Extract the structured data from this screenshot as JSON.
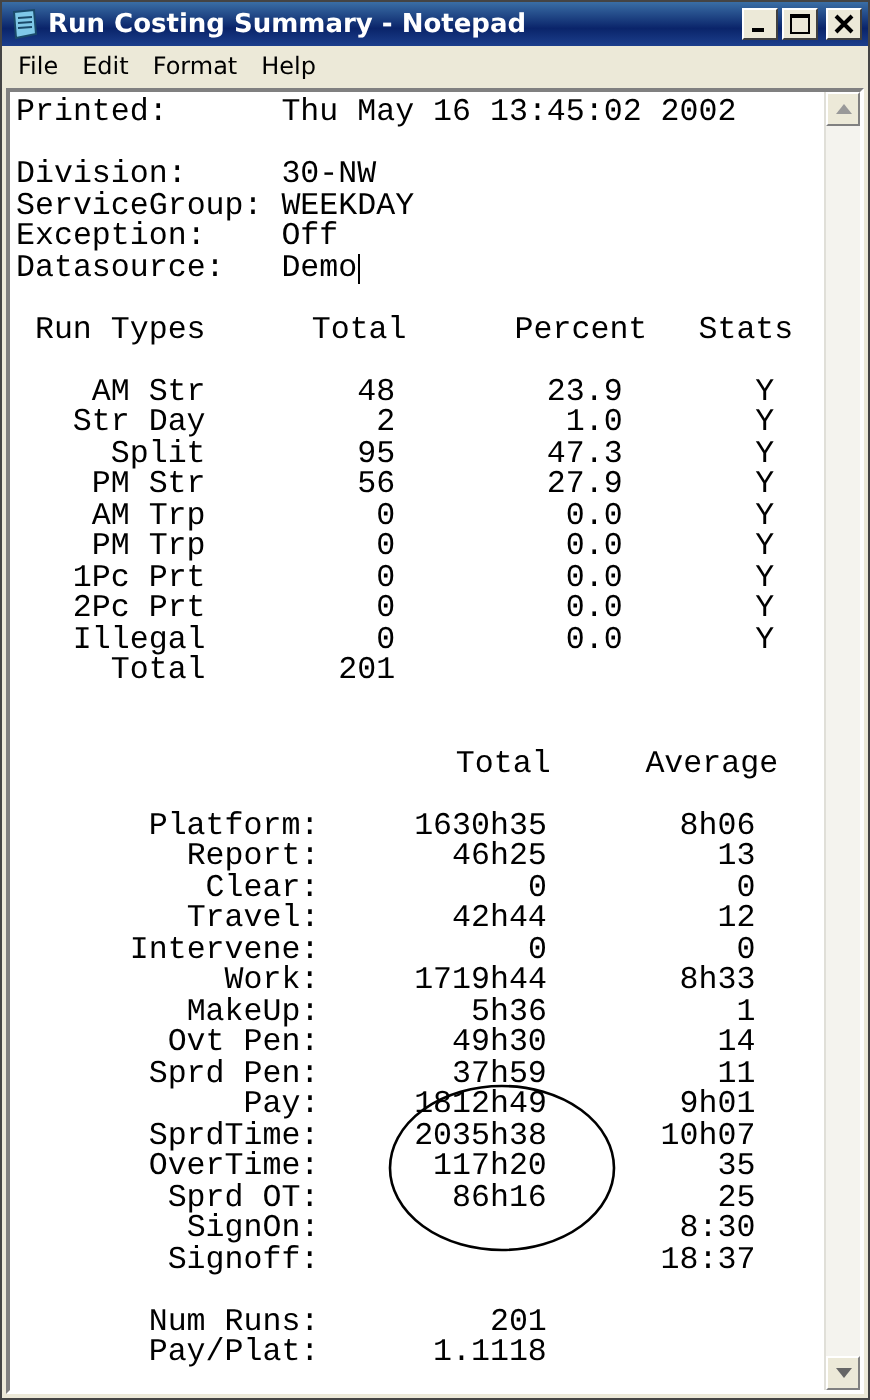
{
  "window": {
    "title": "Run Costing Summary - Notepad"
  },
  "menu": [
    "File",
    "Edit",
    "Format",
    "Help"
  ],
  "header_fields": [
    {
      "label": "Printed:",
      "value": "Thu May 16 13:45:02 2002",
      "caret": false
    },
    {
      "label": "Division:",
      "value": "30-NW",
      "caret": false
    },
    {
      "label": "ServiceGroup:",
      "value": "WEEKDAY",
      "caret": false
    },
    {
      "label": "Exception:",
      "value": "Off",
      "caret": false
    },
    {
      "label": "Datasource:",
      "value": "Demo",
      "caret": true
    }
  ],
  "run_types": {
    "columns": [
      "Run Types",
      "Total",
      "Percent",
      "Stats"
    ],
    "rows": [
      {
        "type": "AM Str",
        "total": "48",
        "percent": "23.9",
        "stats": "Y"
      },
      {
        "type": "Str Day",
        "total": "2",
        "percent": "1.0",
        "stats": "Y"
      },
      {
        "type": "Split",
        "total": "95",
        "percent": "47.3",
        "stats": "Y"
      },
      {
        "type": "PM Str",
        "total": "56",
        "percent": "27.9",
        "stats": "Y"
      },
      {
        "type": "AM Trp",
        "total": "0",
        "percent": "0.0",
        "stats": "Y"
      },
      {
        "type": "PM Trp",
        "total": "0",
        "percent": "0.0",
        "stats": "Y"
      },
      {
        "type": "1Pc Prt",
        "total": "0",
        "percent": "0.0",
        "stats": "Y"
      },
      {
        "type": "2Pc Prt",
        "total": "0",
        "percent": "0.0",
        "stats": "Y"
      },
      {
        "type": "Illegal",
        "total": "0",
        "percent": "0.0",
        "stats": "Y"
      }
    ],
    "total": {
      "label": "Total",
      "value": "201"
    }
  },
  "times": {
    "columns": [
      "Total",
      "Average"
    ],
    "rows": [
      {
        "label": "Platform:",
        "total": "1630h35",
        "average": "8h06"
      },
      {
        "label": "Report:",
        "total": "46h25",
        "average": "13"
      },
      {
        "label": "Clear:",
        "total": "0",
        "average": "0"
      },
      {
        "label": "Travel:",
        "total": "42h44",
        "average": "12"
      },
      {
        "label": "Intervene:",
        "total": "0",
        "average": "0"
      },
      {
        "label": "Work:",
        "total": "1719h44",
        "average": "8h33"
      },
      {
        "label": "MakeUp:",
        "total": "5h36",
        "average": "1"
      },
      {
        "label": "Ovt Pen:",
        "total": "49h30",
        "average": "14"
      },
      {
        "label": "Sprd Pen:",
        "total": "37h59",
        "average": "11"
      },
      {
        "label": "Pay:",
        "total": "1812h49",
        "average": "9h01"
      },
      {
        "label": "SprdTime:",
        "total": "2035h38",
        "average": "10h07"
      },
      {
        "label": "OverTime:",
        "total": "117h20",
        "average": "35"
      },
      {
        "label": "Sprd OT:",
        "total": "86h16",
        "average": "25"
      },
      {
        "label": "SignOn:",
        "average": "8:30"
      },
      {
        "label": "Signoff:",
        "average": "18:37"
      }
    ]
  },
  "summary": [
    {
      "label": "Num Runs:",
      "value": "201"
    },
    {
      "label": "Pay/Plat:",
      "value": "1.1118"
    }
  ]
}
